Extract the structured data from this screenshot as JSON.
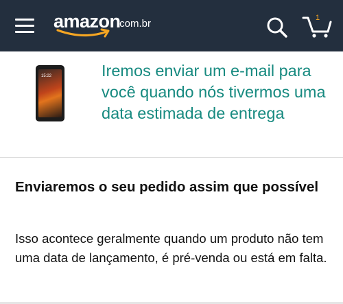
{
  "header": {
    "logo_word": "amazon",
    "logo_suffix": ".com.br",
    "cart_count": "1",
    "icons": {
      "menu": "hamburger-menu-icon",
      "search": "search-icon",
      "cart": "shopping-cart-icon"
    }
  },
  "product": {
    "image": "smartphone-product-image",
    "clock": "15:22"
  },
  "notice": {
    "text": "Iremos enviar um e-mail para você quando nós tivermos uma data estimada de entrega"
  },
  "info": {
    "title": "Enviaremos o seu pedido assim que possível",
    "body": "Isso acontece geralmente quando um produto não tem uma data de lançamento, é pré-venda ou está em falta."
  },
  "colors": {
    "topbar": "#232f3e",
    "accent_orange": "#f5a623",
    "notice_text": "#178a80"
  }
}
